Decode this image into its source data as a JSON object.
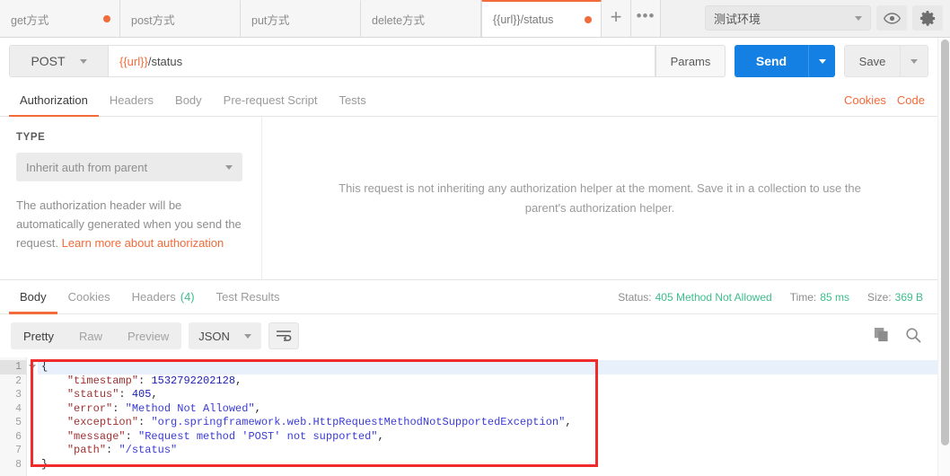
{
  "tabstrip": {
    "tabs": [
      {
        "name": "get方式",
        "unsaved": true,
        "active": false
      },
      {
        "name": "post方式",
        "unsaved": false,
        "active": false
      },
      {
        "name": "put方式",
        "unsaved": false,
        "active": false
      },
      {
        "name": "delete方式",
        "unsaved": false,
        "active": false
      },
      {
        "name": "{{url}}/status",
        "unsaved": true,
        "active": true
      }
    ],
    "new_tab_label": "+",
    "more_label": "•••",
    "environment": "测试环境",
    "eye_icon": "eye-icon",
    "gear_icon": "gear-icon"
  },
  "urlbar": {
    "method": "POST",
    "url_variable": "{{url}}",
    "url_path": "/status",
    "url_full": "{{url}}/status",
    "params_label": "Params",
    "send_label": "Send",
    "save_label": "Save"
  },
  "request_tabs": {
    "items": [
      {
        "label": "Authorization",
        "active": true
      },
      {
        "label": "Headers",
        "active": false
      },
      {
        "label": "Body",
        "active": false
      },
      {
        "label": "Pre-request Script",
        "active": false
      },
      {
        "label": "Tests",
        "active": false
      }
    ],
    "cookies_link": "Cookies",
    "code_link": "Code"
  },
  "authorization": {
    "type_label": "TYPE",
    "type_value": "Inherit auth from parent",
    "description_text": "The authorization header will be automatically generated when you send the request. ",
    "description_link": "Learn more about authorization",
    "empty_note": "This request is not inheriting any authorization helper at the moment. Save it in a collection to use the parent's authorization helper."
  },
  "response": {
    "tabs": [
      {
        "label": "Body",
        "count": "",
        "active": true
      },
      {
        "label": "Cookies",
        "count": "",
        "active": false
      },
      {
        "label": "Headers",
        "count": "(4)",
        "active": false
      },
      {
        "label": "Test Results",
        "count": "",
        "active": false
      }
    ],
    "status_label": "Status:",
    "status_value": "405 Method Not Allowed",
    "time_label": "Time:",
    "time_value": "85 ms",
    "size_label": "Size:",
    "size_value": "369 B",
    "format_tabs": [
      {
        "label": "Pretty",
        "active": true
      },
      {
        "label": "Raw",
        "active": false
      },
      {
        "label": "Preview",
        "active": false
      }
    ],
    "language": "JSON",
    "wrap_icon": "word-wrap-icon",
    "copy_icon": "copy-icon",
    "search_icon": "search-icon"
  },
  "response_body": {
    "line_numbers": [
      "1",
      "2",
      "3",
      "4",
      "5",
      "6",
      "7",
      "8"
    ],
    "lines": [
      [
        {
          "t": "p",
          "v": "{"
        }
      ],
      [
        {
          "t": "p",
          "v": "    "
        },
        {
          "t": "k",
          "v": "\"timestamp\""
        },
        {
          "t": "p",
          "v": ": "
        },
        {
          "t": "n",
          "v": "1532792202128"
        },
        {
          "t": "p",
          "v": ","
        }
      ],
      [
        {
          "t": "p",
          "v": "    "
        },
        {
          "t": "k",
          "v": "\"status\""
        },
        {
          "t": "p",
          "v": ": "
        },
        {
          "t": "n",
          "v": "405"
        },
        {
          "t": "p",
          "v": ","
        }
      ],
      [
        {
          "t": "p",
          "v": "    "
        },
        {
          "t": "k",
          "v": "\"error\""
        },
        {
          "t": "p",
          "v": ": "
        },
        {
          "t": "s",
          "v": "\"Method Not Allowed\""
        },
        {
          "t": "p",
          "v": ","
        }
      ],
      [
        {
          "t": "p",
          "v": "    "
        },
        {
          "t": "k",
          "v": "\"exception\""
        },
        {
          "t": "p",
          "v": ": "
        },
        {
          "t": "s",
          "v": "\"org.springframework.web.HttpRequestMethodNotSupportedException\""
        },
        {
          "t": "p",
          "v": ","
        }
      ],
      [
        {
          "t": "p",
          "v": "    "
        },
        {
          "t": "k",
          "v": "\"message\""
        },
        {
          "t": "p",
          "v": ": "
        },
        {
          "t": "s",
          "v": "\"Request method 'POST' not supported\""
        },
        {
          "t": "p",
          "v": ","
        }
      ],
      [
        {
          "t": "p",
          "v": "    "
        },
        {
          "t": "k",
          "v": "\"path\""
        },
        {
          "t": "p",
          "v": ": "
        },
        {
          "t": "s",
          "v": "\"/status\""
        }
      ],
      [
        {
          "t": "p",
          "v": "}"
        }
      ]
    ],
    "json": {
      "timestamp": 1532792202128,
      "status": 405,
      "error": "Method Not Allowed",
      "exception": "org.springframework.web.HttpRequestMethodNotSupportedException",
      "message": "Request method 'POST' not supported",
      "path": "/status"
    }
  },
  "colors": {
    "accent_orange": "#f26b3a",
    "send_blue": "#1580e3",
    "status_green": "#3dbd8c",
    "annotation_red": "#ef2b2b",
    "json_key": "#a03232",
    "json_string": "#3b3bd6",
    "json_number": "#1d1db5"
  }
}
